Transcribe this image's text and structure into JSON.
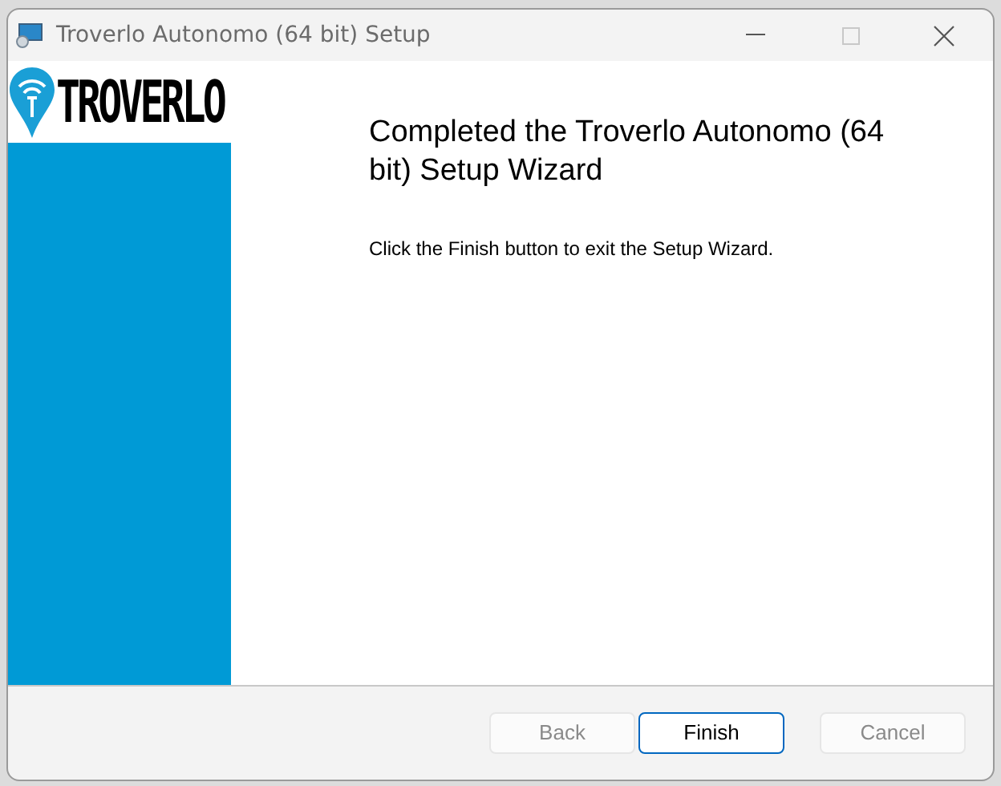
{
  "window": {
    "title": "Troverlo Autonomo (64 bit) Setup"
  },
  "logo": {
    "text": "TROVERLO"
  },
  "heading": "Completed the Troverlo Autonomo (64 bit) Setup Wizard",
  "message": "Click the Finish button to exit the Setup Wizard.",
  "buttons": [
    {
      "label": "Back",
      "disabled": true,
      "default": false
    },
    {
      "label": "Finish",
      "disabled": false,
      "default": true
    },
    {
      "label": "Cancel",
      "disabled": true,
      "default": false
    }
  ]
}
